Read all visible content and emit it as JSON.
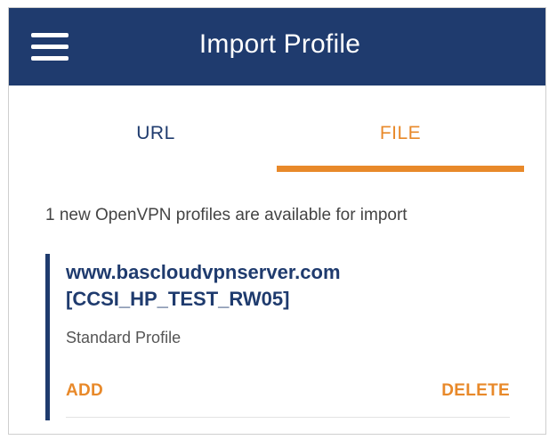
{
  "app_bar": {
    "title": "Import Profile",
    "menu_icon": "hamburger-menu-icon",
    "background_color": "#1f3b6e"
  },
  "tabs": [
    {
      "label": "URL",
      "selected": false
    },
    {
      "label": "FILE",
      "selected": true
    }
  ],
  "accent_color": "#e8892a",
  "info_text": "1 new OpenVPN profiles are available for import",
  "profile": {
    "name": "www.bascloudvpnserver.com",
    "tag": "[CCSI_HP_TEST_RW05]",
    "type": "Standard Profile",
    "add_label": "ADD",
    "delete_label": "DELETE"
  }
}
